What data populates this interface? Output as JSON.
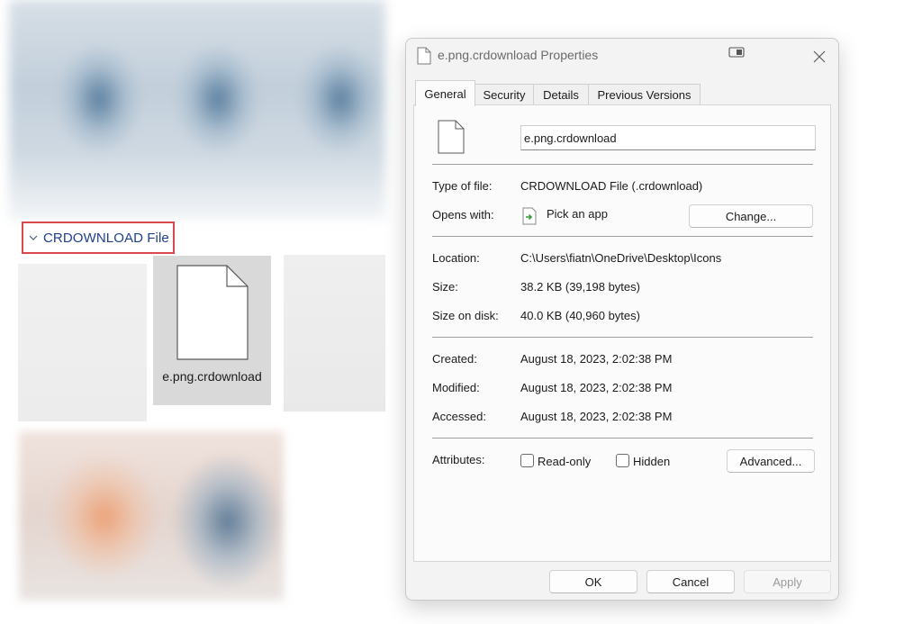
{
  "explorer": {
    "group_label": "CRDOWNLOAD File",
    "selected_file_name": "e.png.crdownload"
  },
  "dialog": {
    "title": "e.png.crdownload Properties",
    "tabs": [
      "General",
      "Security",
      "Details",
      "Previous Versions"
    ],
    "active_tab": "General",
    "file_name": "e.png.crdownload",
    "type_label": "Type of file:",
    "type_value": "CRDOWNLOAD File (.crdownload)",
    "opens_label": "Opens with:",
    "opens_value": "Pick an app",
    "change_button": "Change...",
    "location_label": "Location:",
    "location_value": "C:\\Users\\fiatn\\OneDrive\\Desktop\\Icons",
    "size_label": "Size:",
    "size_value": "38.2 KB (39,198 bytes)",
    "size_disk_label": "Size on disk:",
    "size_disk_value": "40.0 KB (40,960 bytes)",
    "created_label": "Created:",
    "created_value": "August 18, 2023, 2:02:38 PM",
    "modified_label": "Modified:",
    "modified_value": "August 18, 2023, 2:02:38 PM",
    "accessed_label": "Accessed:",
    "accessed_value": "August 18, 2023, 2:02:38 PM",
    "attributes_label": "Attributes:",
    "readonly_label": "Read-only",
    "readonly_checked": false,
    "hidden_label": "Hidden",
    "hidden_checked": false,
    "advanced_button": "Advanced...",
    "ok_button": "OK",
    "cancel_button": "Cancel",
    "apply_button": "Apply"
  },
  "colors": {
    "highlight_border": "#d9484c",
    "group_label": "#1f3f8f",
    "selection": "#d9d9d9"
  }
}
